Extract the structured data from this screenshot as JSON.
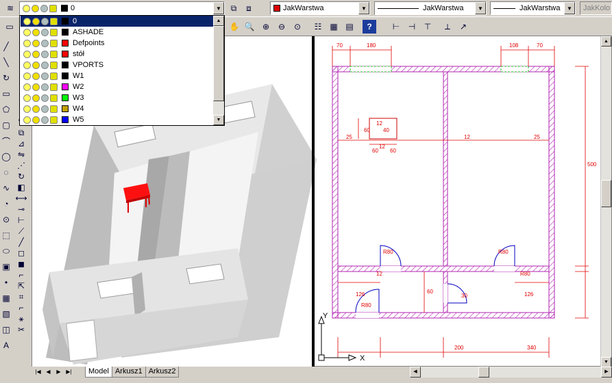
{
  "layer_combo": {
    "current": "0"
  },
  "linetype_combo_1": {
    "value": "JakWarstwa"
  },
  "linetype_combo_2": {
    "value": "JakWarstwa"
  },
  "lineweight_combo": {
    "value": "JakWarstwa"
  },
  "plotstyle_combo": {
    "value": "JakKolo"
  },
  "layers": [
    {
      "name": "0",
      "color": "#000000",
      "selected": true
    },
    {
      "name": "ASHADE",
      "color": "#000000"
    },
    {
      "name": "Defpoints",
      "color": "#ff0000"
    },
    {
      "name": "stół",
      "color": "#ff0000"
    },
    {
      "name": "VPORTS",
      "color": "#000000"
    },
    {
      "name": "W1",
      "color": "#000000"
    },
    {
      "name": "W2",
      "color": "#ff00ff"
    },
    {
      "name": "W3",
      "color": "#00ff00"
    },
    {
      "name": "W4",
      "color": "#c0a000"
    },
    {
      "name": "W5",
      "color": "#0000ff"
    }
  ],
  "tabs": [
    "Model",
    "Arkusz1",
    "Arkusz2"
  ],
  "drawing": {
    "dims": [
      "70",
      "180",
      "108",
      "70",
      "25",
      "12",
      "25",
      "500",
      "12",
      "126",
      "12",
      "126",
      "R80",
      "R80",
      "R80",
      "R80",
      "30",
      "60",
      "200",
      "340",
      "12",
      "60",
      "40",
      "60",
      "60"
    ],
    "ucs": {
      "y": "Y",
      "x": "X"
    }
  }
}
